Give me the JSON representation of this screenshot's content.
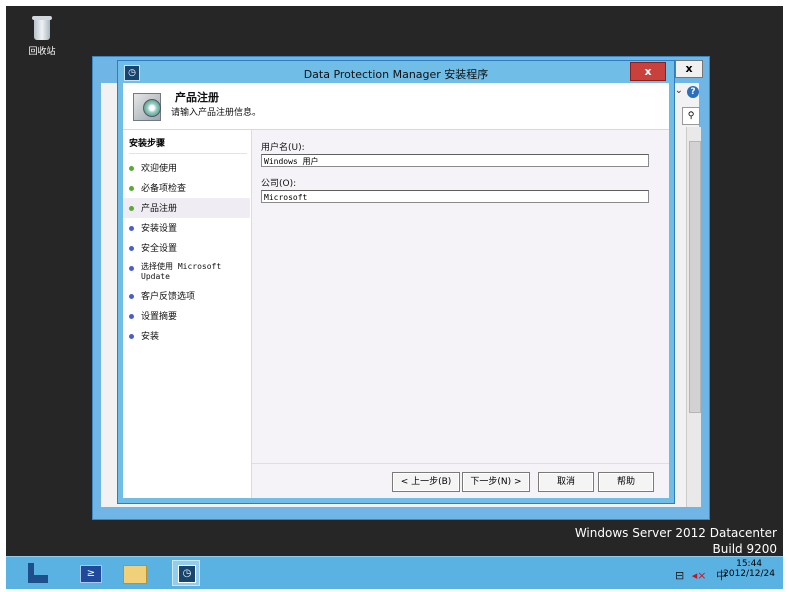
{
  "desktop": {
    "recycle_bin_label": "回收站"
  },
  "dialog": {
    "title": "Data Protection Manager 安装程序",
    "close_label": "x",
    "header": {
      "title": "产品注册",
      "subtitle": "请输入产品注册信息。"
    },
    "steps_title": "安装步骤",
    "steps": [
      {
        "label": "欢迎使用",
        "state": "done"
      },
      {
        "label": "必备项检查",
        "state": "done"
      },
      {
        "label": "产品注册",
        "state": "active"
      },
      {
        "label": "安装设置",
        "state": "pending"
      },
      {
        "label": "安全设置",
        "state": "pending"
      },
      {
        "label": "选择使用 Microsoft",
        "label2": "Update",
        "state": "pending"
      },
      {
        "label": "客户反馈选项",
        "state": "pending"
      },
      {
        "label": "设置摘要",
        "state": "pending"
      },
      {
        "label": "安装",
        "state": "pending"
      }
    ],
    "fields": {
      "username_label": "用户名(U):",
      "username_value": "Windows 用户",
      "company_label": "公司(O):",
      "company_value": "Microsoft"
    },
    "buttons": {
      "back": "< 上一步(B)",
      "next": "下一步(N) >",
      "cancel": "取消",
      "help": "帮助"
    }
  },
  "explorer": {
    "close_label": "x"
  },
  "watermark": {
    "line1": "Windows Server 2012 Datacenter",
    "line2": "Build 9200"
  },
  "taskbar": {
    "time": "15:44",
    "date": "2012/12/24",
    "ime": "中"
  },
  "colors": {
    "dialog_frame": "#70bde8",
    "close_button": "#c9413d",
    "taskbar": "#5ab2e3",
    "desktop": "#262626"
  }
}
